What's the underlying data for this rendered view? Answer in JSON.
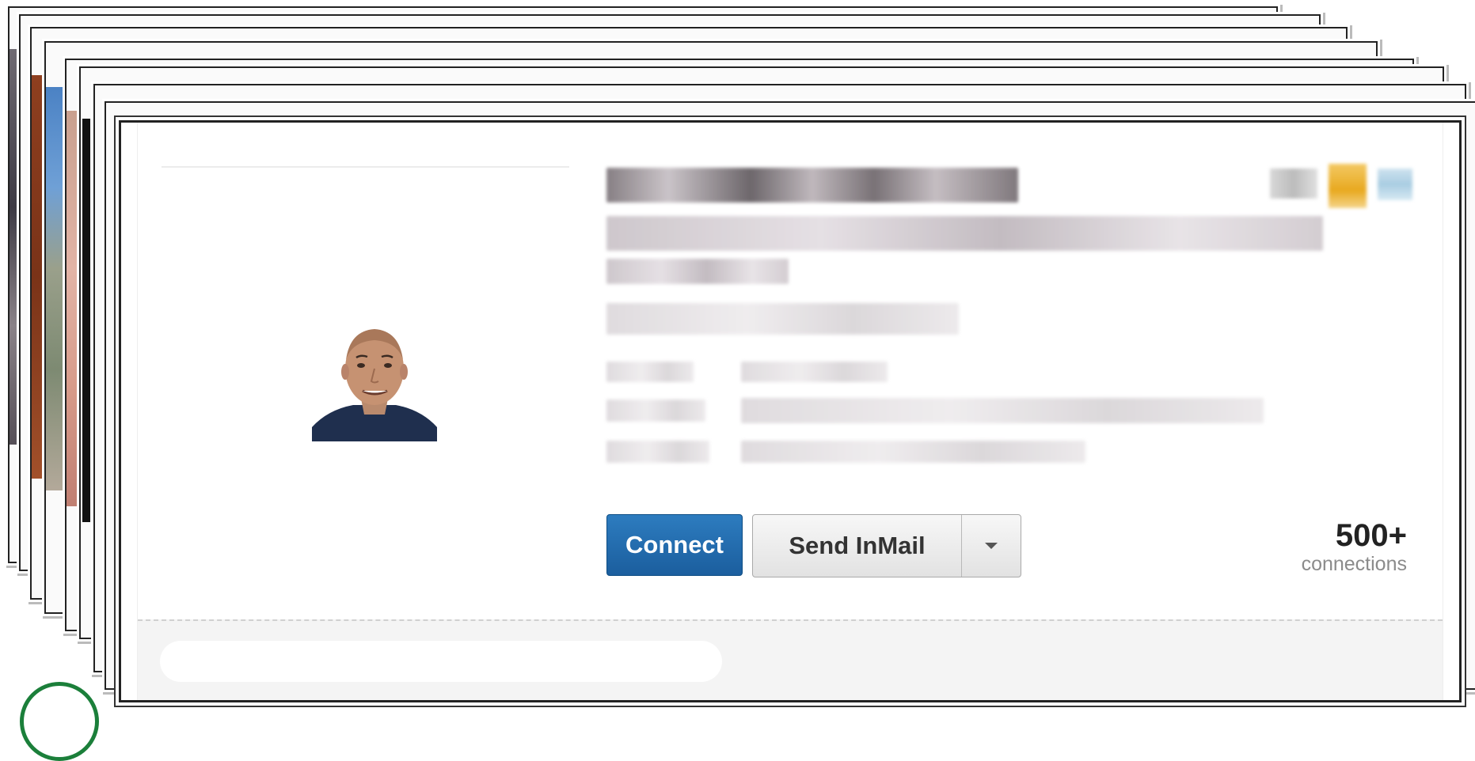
{
  "card": {
    "name": "",
    "headline": "",
    "actions": {
      "connect_label": "Connect",
      "send_inmail_label": "Send InMail",
      "more_icon": "caret-down-icon"
    },
    "connections": {
      "count": "500+",
      "label": "connections"
    }
  },
  "colors": {
    "connect_button": "#1b5e9e",
    "logo_ring": "#1b7f3a"
  }
}
